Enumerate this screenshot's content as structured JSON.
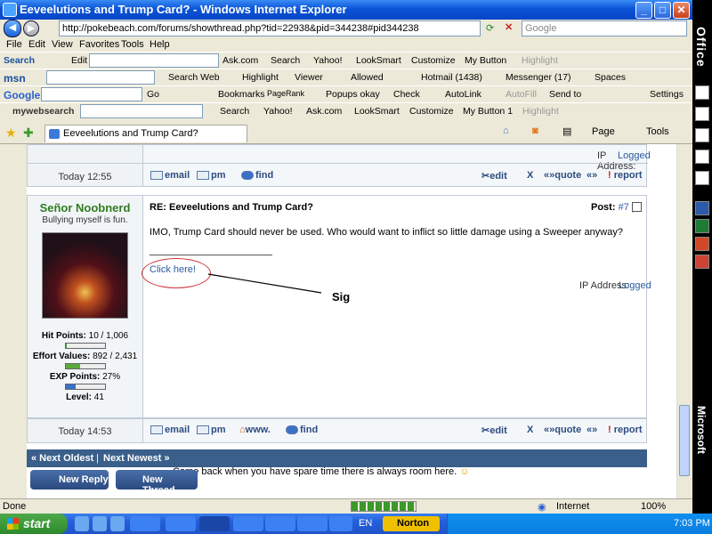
{
  "window": {
    "title": "Eeveelutions and Trump Card? - Windows Internet Explorer"
  },
  "address": {
    "url": "http://pokebeach.com/forums/showthread.php?tid=22938&pid=344238#pid344238",
    "search_placeholder": "Google"
  },
  "menu": [
    "File",
    "Edit",
    "View",
    "Favorites",
    "Tools",
    "Help"
  ],
  "toolbar_mysearch": {
    "label": "Search",
    "edit": "Edit",
    "askcom": "Ask.com",
    "search": "Search",
    "yahoo": "Yahoo!",
    "looksmart": "LookSmart",
    "customize": "Customize",
    "mybutton": "My Button",
    "highlight": "Highlight"
  },
  "toolbar_msn": {
    "search_web": "Search Web",
    "highlight": "Highlight",
    "viewer": "Viewer",
    "allowed": "Allowed",
    "hotmail": "Hotmail (1438)",
    "messenger": "Messenger (17)",
    "spaces": "Spaces"
  },
  "toolbar_google": {
    "go": "Go",
    "bookmarks": "Bookmarks",
    "pagerank": "PageRank",
    "popups": "Popups okay",
    "check": "Check",
    "autolink": "AutoLink",
    "autofill": "AutoFill",
    "sendto": "Send to",
    "settings": "Settings"
  },
  "toolbar_mywebsearch": {
    "brand": "mywebsearch",
    "search": "Search",
    "yahoo": "Yahoo!",
    "askcom": "Ask.com",
    "looksmart": "LookSmart",
    "customize": "Customize",
    "mybutton": "My Button 1",
    "highlight": "Highlight"
  },
  "tab": {
    "title": "Eeveelutions and Trump Card?"
  },
  "command_bar": {
    "page": "Page",
    "tools": "Tools"
  },
  "post_prev": {
    "ip": "IP Address:",
    "logged": "Logged",
    "time": "Today 12:55",
    "buttons": [
      "email",
      "pm",
      "find"
    ],
    "actions": [
      "edit",
      "X",
      "quote",
      "report"
    ]
  },
  "post": {
    "author": "Señor Noobnerd",
    "usertitle": "Bullying myself is fun.",
    "hp_label": "Hit Points:",
    "hp_value": "10 / 1,006",
    "ev_label": "Effort Values:",
    "ev_value": "892 / 2,431",
    "exp_label": "EXP Points:",
    "exp_value": "27%",
    "level_label": "Level:",
    "level_value": "41",
    "hp_frac": 0.01,
    "ev_frac": 0.367,
    "exp_frac": 0.27,
    "subject": "RE: Eeveelutions and Trump Card?",
    "post_label": "Post:",
    "post_number": "#7",
    "body": "IMO, Trump Card should never be used. Who would want to inflict so little damage using a Sweeper anyway?",
    "signature_link": "Click here!",
    "annotation": "Sig",
    "ip": "IP Address:",
    "logged": "Logged",
    "time": "Today 14:53",
    "buttons": [
      "email",
      "pm",
      "www.",
      "find"
    ],
    "actions": [
      "edit",
      "X",
      "quote",
      "report"
    ]
  },
  "nav": {
    "prev": "« Next Oldest",
    "sep": "|",
    "next": "Next Newest »"
  },
  "quick": {
    "text": "Come back when you have spare time there is always room here.",
    "new_reply": "New Reply",
    "new_thread": "New Thread"
  },
  "status": {
    "left": "Done",
    "zone": "Internet",
    "zoom": "100%"
  },
  "taskbar": {
    "start": "start",
    "lang": "EN",
    "norton": "Norton",
    "clock": "7:03 PM"
  },
  "sidebar": {
    "office": "Office",
    "microsoft": "Microsoft"
  }
}
